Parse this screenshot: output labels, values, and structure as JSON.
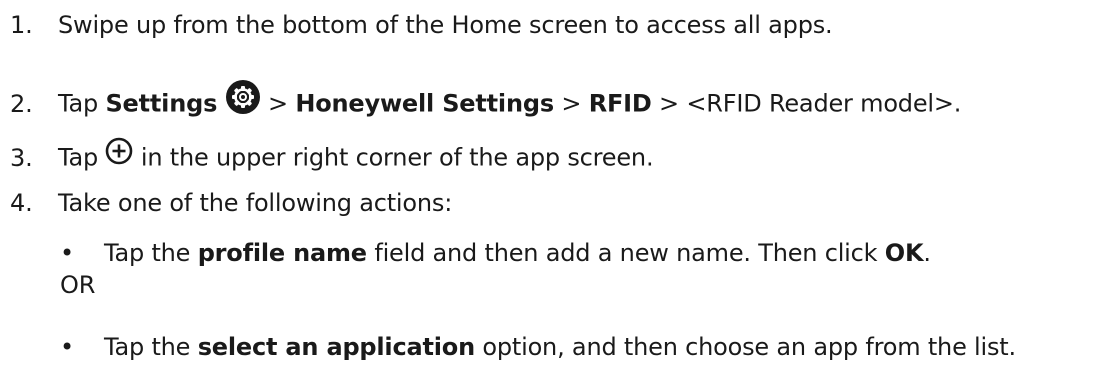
{
  "steps": [
    {
      "number": "1.",
      "text": "Swipe up from the bottom of the Home screen to access all apps."
    },
    {
      "number": "2.",
      "prefix": "Tap ",
      "settings": "Settings",
      "sep1": " > ",
      "honeywell": "Honeywell Settings",
      "sep2": " > ",
      "rfid": "RFID",
      "suffix": " > <RFID Reader model>."
    },
    {
      "number": "3.",
      "prefix": "Tap ",
      "suffix": " in the upper right corner of the app screen."
    },
    {
      "number": "4.",
      "text": "Take one of the following actions:"
    }
  ],
  "bullets": [
    {
      "marker": "•",
      "prefix": "Tap the ",
      "bold": "profile name",
      "middle": " field and then add a new name. Then click ",
      "bold2": "OK",
      "suffix": "."
    },
    {
      "marker": "•",
      "prefix": "Tap the ",
      "bold": "select an application",
      "suffix": " option, and then choose an app from the list."
    }
  ],
  "or_text": "OR",
  "icons": {
    "settings": "settings-gear-icon",
    "add": "add-circle-icon"
  },
  "colors": {
    "text": "#1a1a1a"
  }
}
